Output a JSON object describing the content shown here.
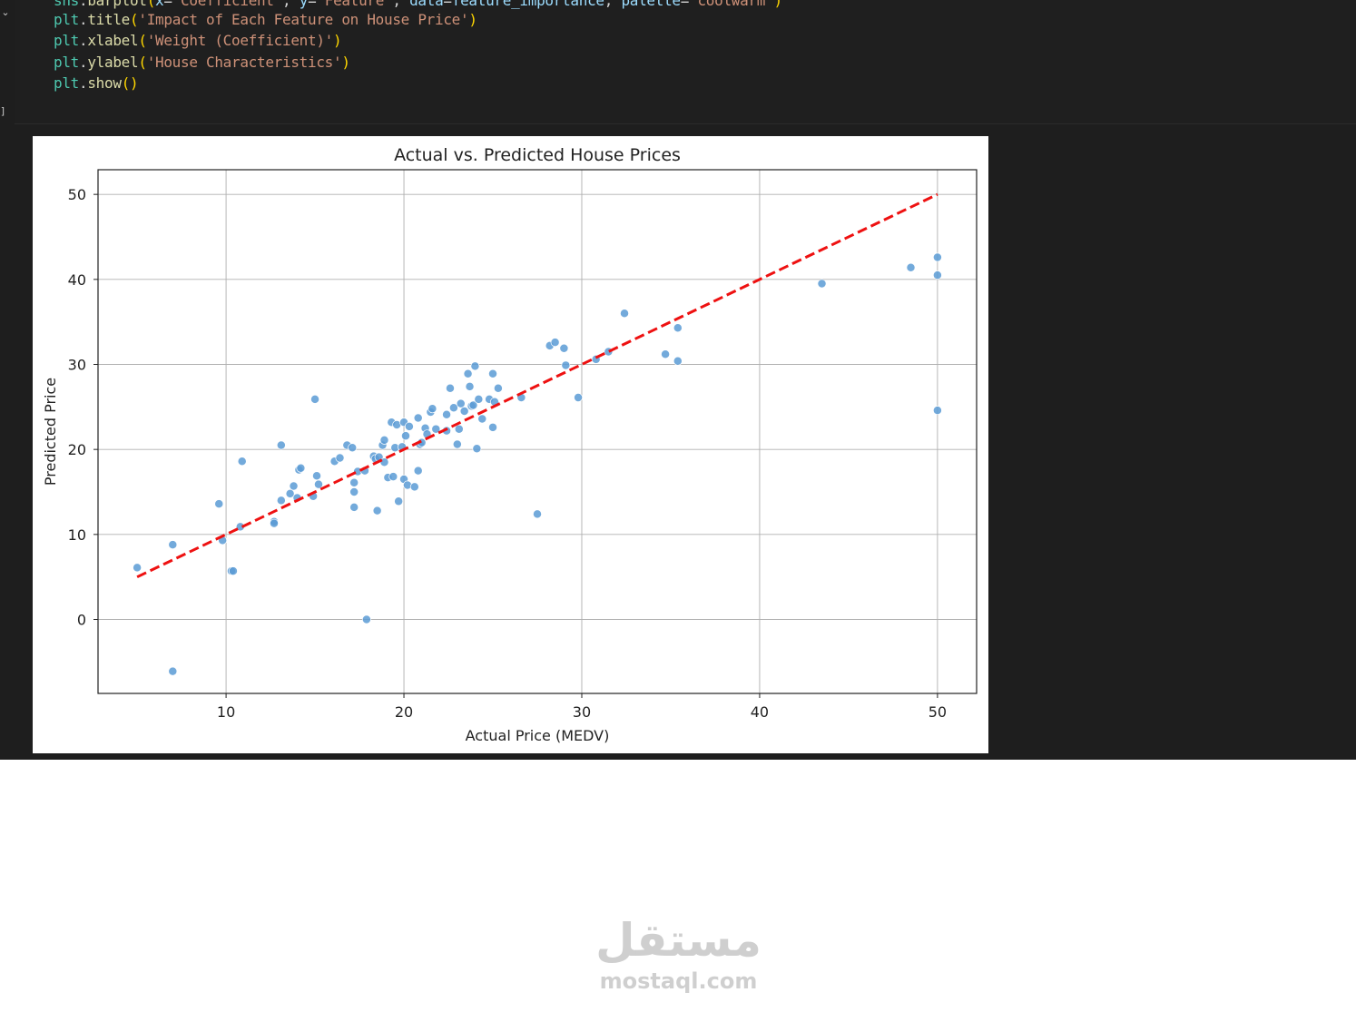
{
  "code_cell": {
    "lines": [
      {
        "parts": [
          [
            "var",
            "sns"
          ],
          [
            "op",
            "."
          ],
          [
            "fn",
            "barplot"
          ],
          [
            "paren",
            "("
          ],
          [
            "id",
            "x"
          ],
          [
            "op",
            "="
          ],
          [
            "str",
            "'Coefficient'"
          ],
          [
            "op",
            ", "
          ],
          [
            "id",
            "y"
          ],
          [
            "op",
            "="
          ],
          [
            "str",
            "'Feature'"
          ],
          [
            "op",
            ", "
          ],
          [
            "id",
            "data"
          ],
          [
            "op",
            "="
          ],
          [
            "id",
            "feature_importance"
          ],
          [
            "op",
            ", "
          ],
          [
            "id",
            "palette"
          ],
          [
            "op",
            "="
          ],
          [
            "str",
            "'coolwarm'"
          ],
          [
            "paren",
            ")"
          ]
        ]
      },
      {
        "parts": [
          [
            "var",
            "plt"
          ],
          [
            "op",
            "."
          ],
          [
            "fn",
            "title"
          ],
          [
            "paren",
            "("
          ],
          [
            "str",
            "'Impact of Each Feature on House Price'"
          ],
          [
            "paren",
            ")"
          ]
        ]
      },
      {
        "parts": [
          [
            "var",
            "plt"
          ],
          [
            "op",
            "."
          ],
          [
            "fn",
            "xlabel"
          ],
          [
            "paren",
            "("
          ],
          [
            "str",
            "'Weight (Coefficient)'"
          ],
          [
            "paren",
            ")"
          ]
        ]
      },
      {
        "parts": [
          [
            "var",
            "plt"
          ],
          [
            "op",
            "."
          ],
          [
            "fn",
            "ylabel"
          ],
          [
            "paren",
            "("
          ],
          [
            "str",
            "'House Characteristics'"
          ],
          [
            "paren",
            ")"
          ]
        ]
      },
      {
        "parts": [
          [
            "var",
            "plt"
          ],
          [
            "op",
            "."
          ],
          [
            "fn",
            "show"
          ],
          [
            "paren",
            "()"
          ]
        ]
      }
    ],
    "collapse_glyph": "⌄",
    "exec_bracket": "]"
  },
  "chart_data": {
    "type": "scatter",
    "title": "Actual vs. Predicted House Prices",
    "xlabel": "Actual Price (MEDV)",
    "ylabel": "Predicted Price",
    "xlim": [
      2.8,
      52.2
    ],
    "ylim": [
      -8.7,
      52.9
    ],
    "xticks": [
      10,
      20,
      30,
      40,
      50
    ],
    "yticks": [
      0,
      10,
      20,
      30,
      40,
      50
    ],
    "grid": true,
    "point_color": "#5b9bd5",
    "reference_line": {
      "x": [
        5,
        50
      ],
      "y": [
        5,
        50
      ],
      "color": "#ee1111",
      "style": "dashed"
    },
    "points": [
      [
        5.0,
        6.1
      ],
      [
        7.0,
        8.8
      ],
      [
        7.0,
        -6.1
      ],
      [
        9.6,
        13.6
      ],
      [
        9.8,
        9.3
      ],
      [
        10.3,
        5.7
      ],
      [
        10.4,
        5.7
      ],
      [
        10.8,
        10.9
      ],
      [
        10.9,
        18.6
      ],
      [
        12.7,
        11.5
      ],
      [
        12.7,
        11.3
      ],
      [
        13.1,
        14.0
      ],
      [
        13.1,
        20.5
      ],
      [
        13.6,
        14.8
      ],
      [
        13.8,
        15.7
      ],
      [
        14.0,
        14.3
      ],
      [
        14.1,
        17.6
      ],
      [
        14.2,
        17.8
      ],
      [
        14.9,
        14.5
      ],
      [
        15.0,
        25.9
      ],
      [
        15.1,
        16.9
      ],
      [
        15.2,
        15.9
      ],
      [
        16.1,
        18.6
      ],
      [
        16.4,
        19.0
      ],
      [
        16.8,
        20.5
      ],
      [
        17.1,
        20.2
      ],
      [
        17.2,
        16.1
      ],
      [
        17.2,
        15.0
      ],
      [
        17.2,
        13.2
      ],
      [
        17.4,
        17.4
      ],
      [
        17.8,
        17.5
      ],
      [
        17.9,
        0.0
      ],
      [
        18.3,
        19.2
      ],
      [
        18.4,
        18.9
      ],
      [
        18.5,
        12.8
      ],
      [
        18.6,
        19.1
      ],
      [
        18.8,
        20.5
      ],
      [
        18.9,
        21.1
      ],
      [
        18.9,
        18.5
      ],
      [
        19.1,
        16.7
      ],
      [
        19.3,
        23.2
      ],
      [
        19.4,
        16.8
      ],
      [
        19.5,
        20.2
      ],
      [
        19.6,
        22.9
      ],
      [
        19.7,
        13.9
      ],
      [
        19.9,
        20.3
      ],
      [
        20.0,
        23.2
      ],
      [
        20.0,
        16.5
      ],
      [
        20.1,
        21.6
      ],
      [
        20.2,
        15.8
      ],
      [
        20.3,
        22.7
      ],
      [
        20.6,
        15.6
      ],
      [
        20.8,
        23.7
      ],
      [
        20.8,
        17.5
      ],
      [
        20.9,
        20.6
      ],
      [
        21.0,
        20.8
      ],
      [
        21.2,
        22.5
      ],
      [
        21.3,
        21.8
      ],
      [
        21.5,
        24.4
      ],
      [
        21.6,
        24.8
      ],
      [
        21.8,
        22.4
      ],
      [
        22.4,
        22.2
      ],
      [
        22.4,
        24.1
      ],
      [
        22.6,
        27.2
      ],
      [
        22.8,
        24.9
      ],
      [
        23.0,
        20.6
      ],
      [
        23.1,
        22.4
      ],
      [
        23.2,
        25.4
      ],
      [
        23.4,
        24.5
      ],
      [
        23.6,
        28.9
      ],
      [
        23.7,
        27.4
      ],
      [
        23.8,
        25.1
      ],
      [
        23.9,
        25.2
      ],
      [
        24.0,
        29.8
      ],
      [
        24.1,
        20.1
      ],
      [
        24.2,
        25.9
      ],
      [
        24.4,
        23.6
      ],
      [
        24.8,
        25.9
      ],
      [
        25.0,
        28.9
      ],
      [
        25.0,
        22.6
      ],
      [
        25.1,
        25.6
      ],
      [
        25.3,
        27.2
      ],
      [
        26.6,
        26.1
      ],
      [
        27.5,
        12.4
      ],
      [
        28.2,
        32.2
      ],
      [
        28.5,
        32.6
      ],
      [
        29.0,
        31.9
      ],
      [
        29.1,
        29.9
      ],
      [
        29.8,
        26.1
      ],
      [
        30.8,
        30.6
      ],
      [
        31.5,
        31.5
      ],
      [
        32.4,
        36.0
      ],
      [
        34.7,
        31.2
      ],
      [
        35.4,
        34.3
      ],
      [
        35.4,
        30.4
      ],
      [
        43.5,
        39.5
      ],
      [
        48.5,
        41.4
      ],
      [
        50.0,
        42.6
      ],
      [
        50.0,
        40.5
      ],
      [
        50.0,
        24.6
      ]
    ]
  },
  "watermark": {
    "arabic": "مستقل",
    "latin": "mostaql.com"
  }
}
